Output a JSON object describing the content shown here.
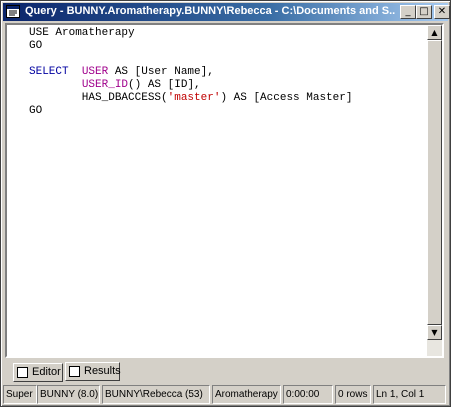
{
  "window": {
    "title": "Query - BUNNY.Aromatherapy.BUNNY\\Rebecca - C:\\Documents and S...",
    "min_label": "_",
    "max_label": "□",
    "close_label": "✕"
  },
  "editor": {
    "lines": [
      {
        "parts": [
          {
            "text": "USE Aromatherapy",
            "cls": ""
          }
        ]
      },
      {
        "parts": [
          {
            "text": "GO",
            "cls": ""
          }
        ]
      },
      {
        "parts": [
          {
            "text": "",
            "cls": ""
          }
        ]
      },
      {
        "parts": [
          {
            "text": "SELECT  ",
            "cls": "kw"
          },
          {
            "text": "USER",
            "cls": "fn"
          },
          {
            "text": " AS [User Name],",
            "cls": ""
          }
        ]
      },
      {
        "parts": [
          {
            "text": "        ",
            "cls": ""
          },
          {
            "text": "USER_ID",
            "cls": "fn"
          },
          {
            "text": "() AS [ID],",
            "cls": ""
          }
        ]
      },
      {
        "parts": [
          {
            "text": "        HAS_DBACCESS(",
            "cls": ""
          },
          {
            "text": "'master'",
            "cls": "str"
          },
          {
            "text": ") AS [Access Master]",
            "cls": ""
          }
        ]
      },
      {
        "parts": [
          {
            "text": "GO",
            "cls": ""
          }
        ]
      }
    ]
  },
  "scroll": {
    "up_arrow": "▲",
    "down_arrow": "▼"
  },
  "tabs": [
    {
      "label": "Editor",
      "icon": "document-icon"
    },
    {
      "label": "Results",
      "icon": "grid-icon"
    }
  ],
  "status": {
    "server_type": "Super",
    "server": "BUNNY (8.0)",
    "user": "BUNNY\\Rebecca (53)",
    "database": "Aromatherapy",
    "elapsed": "0:00:00",
    "rows": "0 rows",
    "position": "Ln 1, Col 1"
  },
  "colors": {
    "keyword": "#0000a0",
    "function": "#a0008c",
    "string": "#c00000",
    "titlebar_start": "#0a246a"
  }
}
